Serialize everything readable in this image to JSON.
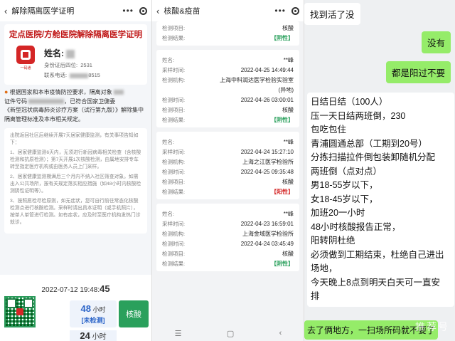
{
  "panel1": {
    "title": "解除隔离医学证明",
    "cert_title": "定点医院/方舱医院解除隔离医学证明",
    "logo_text": "一码通",
    "name_label": "姓名:",
    "id_label": "身份证后四位:",
    "id_value": "2531",
    "phone_label": "联系电话:",
    "phone_value": "8515",
    "notice_lines": [
      "根据国家和本市疫情防控要求，隔离对象",
      "证件号码",
      "，已符合国家卫健委",
      "《新型冠状病毒肺炎诊疗方案（试行第九版）》解除集中",
      "隔离管理标准及本市相关规定。"
    ],
    "info_paragraphs": [
      "出院返回社区后继续开展7天居家健康监测，有关事项告知如下：",
      "1、居家健康监测6天内，无须进行新冠病毒相关检查（含核酸检测和抗原检测）；第7天开展1次核酸检测，由属地安排专车转至指定医疗机构或由医务人员上门采样。",
      "2、居家健康监测期满后三个月内不纳入社区筛查对象。如需出入公共场所，按有关规定落实相应措施（如48小时内核酸检测阴性证明等）。",
      "3、按照愿检尽检原则，如无症状，您可自行前往常态化核酸检测点进行核酸检测。采样时请出具本证明（或手机照片），按单人单管进行检测。如有症状，应及时至医疗机构发热门诊就诊。"
    ],
    "timestamp": "2022-07-12 19:48:",
    "timestamp_sec": "45",
    "hours_value": "48",
    "hours_unit": "小时",
    "hours_status": "[未检测]",
    "hours_value2": "24",
    "hesuan_label": "核酸"
  },
  "panel2": {
    "title": "核酸&疫苗",
    "records": [
      {
        "fields": [
          {
            "label": "检测项目:",
            "value": "核酸"
          },
          {
            "label": "检测结果:",
            "value": "【阴性】",
            "type": "neg"
          }
        ]
      },
      {
        "fields": [
          {
            "label": "姓名:",
            "value": "**峰"
          },
          {
            "label": "采样时间:",
            "value": "2022-04-25 14:49:44"
          },
          {
            "label": "检测机构:",
            "value": "上海中科润达医学检验实验室"
          },
          {
            "label": "",
            "value": "(异地)"
          },
          {
            "label": "检测时间:",
            "value": "2022-04-26 03:00:01"
          },
          {
            "label": "检测项目:",
            "value": "核酸"
          },
          {
            "label": "检测结果:",
            "value": "【阴性】",
            "type": "neg"
          }
        ]
      },
      {
        "fields": [
          {
            "label": "姓名:",
            "value": "**峰"
          },
          {
            "label": "采样时间:",
            "value": "2022-04-24 15:27:10"
          },
          {
            "label": "检测机构:",
            "value": "上海之江医学检验所"
          },
          {
            "label": "检测时间:",
            "value": "2022-04-25 09:35:48"
          },
          {
            "label": "检测项目:",
            "value": "核酸"
          },
          {
            "label": "检测结果:",
            "value": "【阳性】",
            "type": "pos"
          }
        ]
      },
      {
        "fields": [
          {
            "label": "姓名:",
            "value": "**峰"
          },
          {
            "label": "采样时间:",
            "value": "2022-04-23 16:59:01"
          },
          {
            "label": "检测机构:",
            "value": "上海金域医学检验所"
          },
          {
            "label": "检测时间:",
            "value": "2022-04-24 03:45:49"
          },
          {
            "label": "检测项目:",
            "value": "核酸"
          },
          {
            "label": "检测结果:",
            "value": "【阴性】",
            "type": "neg"
          }
        ]
      }
    ],
    "nav_icons": [
      "menu-icon",
      "home-icon",
      "back-icon"
    ],
    "nav_glyphs": [
      "☰",
      "▢",
      "‹"
    ]
  },
  "panel3": {
    "msg1": "找到活了没",
    "msg2": "没有",
    "msg3": "都是阳过不要",
    "long_lines": [
      "日结日结（100人）",
      "压一天日结两班倒，230",
      "包吃包住",
      "青浦圆通总部（工期到20号）",
      "分拣扫描拉件倒包装卸随机分配",
      "两班倒（点对点）",
      "男18-55岁以下，",
      "女18-45岁以下，",
      "加班20一小时",
      "48小时核酸报告正常，",
      "阳转阴杜绝",
      "必须做到工期结束，杜绝自己进出",
      "场地，",
      "今天晚上8点到明天白天可一直安",
      "排"
    ],
    "msg4": "去了俩地方，一扫场所码就不要了",
    "watermark": "推荐号"
  },
  "colors": {
    "accent_red": "#c01818",
    "negative_green": "#2aa05c",
    "positive_red": "#d42626",
    "wechat_green": "#95ec69"
  }
}
